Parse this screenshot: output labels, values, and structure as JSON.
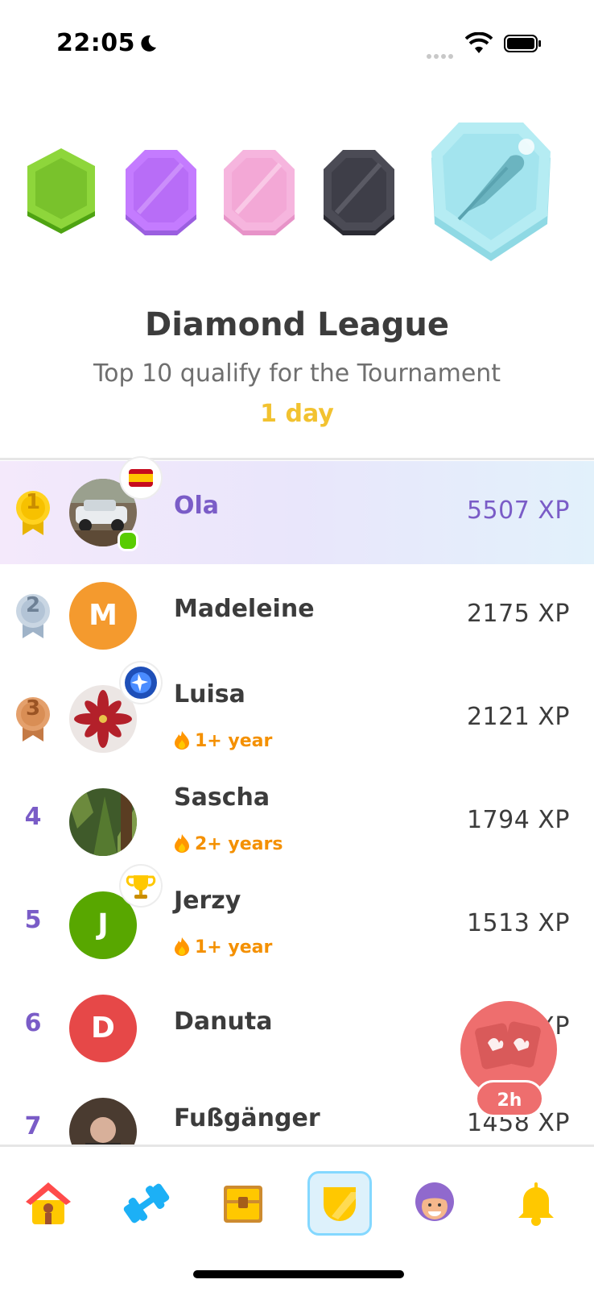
{
  "status_bar": {
    "time": "22:05",
    "icons": [
      "moon-icon",
      "signal-icon",
      "wifi-icon",
      "battery-icon"
    ]
  },
  "leagues": {
    "badges": [
      "green-league-badge",
      "purple-league-badge",
      "pink-league-badge",
      "black-league-badge",
      "diamond-league-badge"
    ],
    "current_icon": "feather-icon"
  },
  "header": {
    "title": "Diamond League",
    "subtitle": "Top 10 qualify for the Tournament",
    "time_left": "1 day"
  },
  "leaderboard": [
    {
      "rank": "1",
      "name": "Ola",
      "xp": "5507 XP",
      "highlight": true,
      "badge": "spain-flag-icon",
      "online": true
    },
    {
      "rank": "2",
      "name": "Madeleine",
      "xp": "2175 XP",
      "avatar_letter": "M",
      "avatar_color": "#f49a2e"
    },
    {
      "rank": "3",
      "name": "Luisa",
      "xp": "2121 XP",
      "streak": "1+ year",
      "badge": "blue-orb-icon"
    },
    {
      "rank": "4",
      "name": "Sascha",
      "xp": "1794 XP",
      "streak": "2+ years"
    },
    {
      "rank": "5",
      "name": "Jerzy",
      "xp": "1513 XP",
      "streak": "1+ year",
      "avatar_letter": "J",
      "avatar_color": "#58a700",
      "badge": "trophy-icon"
    },
    {
      "rank": "6",
      "name": "Danuta",
      "xp": "XP",
      "avatar_letter": "D",
      "avatar_color": "#e64848"
    },
    {
      "rank": "7",
      "name": "Fußgänger",
      "xp": "1458 XP"
    }
  ],
  "floating_button": {
    "timer": "2h",
    "icon": "cards-icon"
  },
  "bottom_nav": [
    {
      "name": "home",
      "icon": "house-icon"
    },
    {
      "name": "practice",
      "icon": "dumbbell-icon"
    },
    {
      "name": "chest",
      "icon": "treasure-chest-icon"
    },
    {
      "name": "leagues",
      "icon": "shield-icon",
      "active": true
    },
    {
      "name": "profile",
      "icon": "avatar-icon"
    },
    {
      "name": "notifications",
      "icon": "bell-icon"
    }
  ],
  "colors": {
    "accent_gold": "#f2c230",
    "rank_purple": "#7a5cc7",
    "streak_orange": "#f49000",
    "online_green": "#58cc02"
  }
}
